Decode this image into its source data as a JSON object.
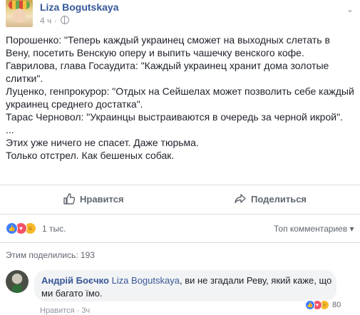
{
  "post": {
    "author": "Liza Bogutskaya",
    "time": "4 ч",
    "lines": [
      "Порошенко: \"Теперь каждый украинец сможет на выходных слетать в",
      "Вену, посетить Венскую оперу и выпить чашечку венского кофе.",
      "Гаврилова, глава Госаудита: \"Каждый украинец хранит дома золотые",
      "слитки\".",
      "Луценко, генпрокурор: \"Отдых на Сейшелах может позволить себе каждый",
      "украинец среднего достатка\".",
      "Тарас Черновол: \"Украинцы выстраиваются в очередь за черной икрой\".",
      "...",
      "Этих уже ничего не спасет. Даже тюрьма.",
      "Только отстрел. Как бешеных собак."
    ]
  },
  "actions": {
    "like_label": "Нравится",
    "share_label": "Поделиться"
  },
  "stats": {
    "reactions_count": "1 тыс.",
    "top_comments": "Топ комментариев ▾",
    "shared_text": "Этим поделились: 193"
  },
  "comment": {
    "author": "Андрій Боєчко",
    "mention": "Liza Bogutskaya",
    "text_1": ", ви не згадали Реву, який каже, що",
    "text_2": "ми багато їмо.",
    "reactions_count": "80",
    "cut_text": "Нравится · 3ч"
  },
  "colors": {
    "link": "#365899",
    "like": "#4080ff",
    "love": "#f25268",
    "haha": "#f7b928"
  }
}
